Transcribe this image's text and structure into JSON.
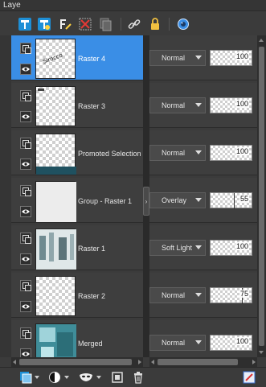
{
  "panel": {
    "title": "Laye"
  },
  "toolbar": {
    "icons": [
      "new-raster-layer-icon",
      "new-vector-layer-icon",
      "edit-selection-icon",
      "delete-icon",
      "duplicate-icon",
      "link-icon",
      "lock-icon",
      "camera-icon"
    ]
  },
  "layers": [
    {
      "name": "Raster 4",
      "blend_mode": "Normal",
      "opacity": "100",
      "selected": true
    },
    {
      "name": "Raster 3",
      "blend_mode": "Normal",
      "opacity": "100",
      "selected": false
    },
    {
      "name": "Promoted Selection",
      "blend_mode": "Normal",
      "opacity": "100",
      "selected": false
    },
    {
      "name": "Group - Raster 1",
      "blend_mode": "Overlay",
      "opacity": "55",
      "selected": false
    },
    {
      "name": "Raster 1",
      "blend_mode": "Soft Light",
      "opacity": "100",
      "selected": false
    },
    {
      "name": "Raster 2",
      "blend_mode": "Normal",
      "opacity": "75",
      "selected": false
    },
    {
      "name": "Merged",
      "blend_mode": "Normal",
      "opacity": "100",
      "selected": false
    }
  ],
  "colors": {
    "selected_row": "#3a8ee6",
    "panel_bg": "#3b3b3b",
    "row_bg": "#3e3e3e"
  }
}
